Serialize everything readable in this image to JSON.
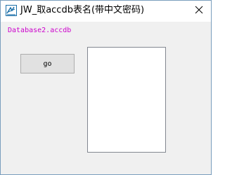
{
  "window": {
    "title": "JW_取accdb表名(带中文密码)",
    "close_glyph": "✕",
    "app_icon": "app-icon",
    "title_color": "#000000"
  },
  "main": {
    "file_label": "Database2.accdb",
    "file_label_color": "#cc00cc",
    "go_button_label": "go",
    "table_list_items": []
  }
}
